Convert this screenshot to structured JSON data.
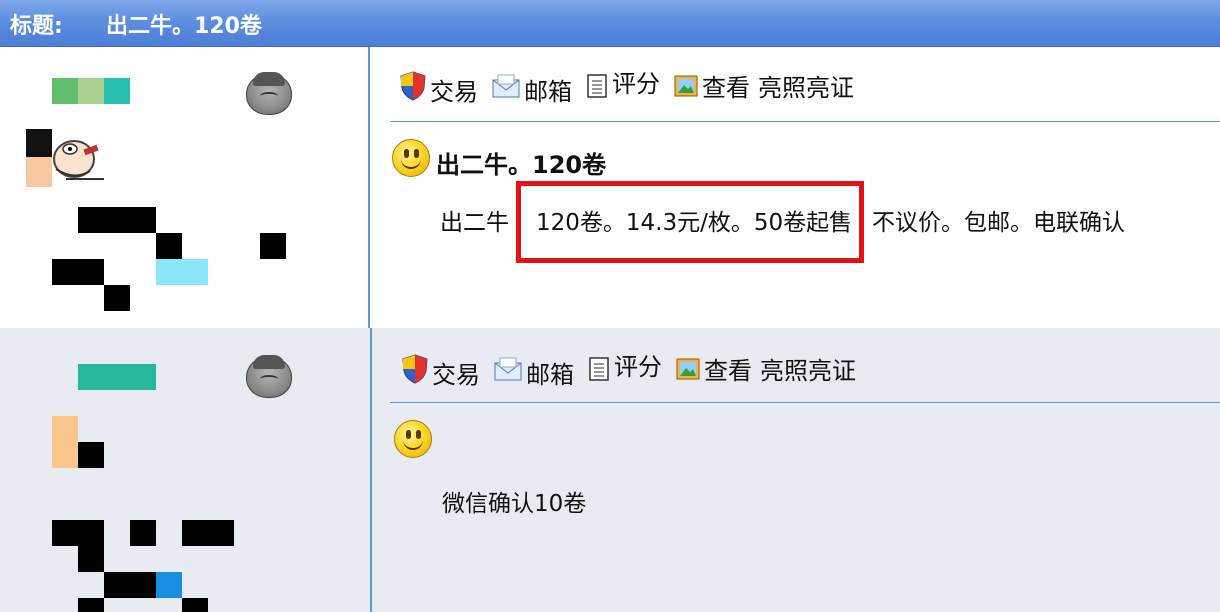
{
  "title_bar": {
    "label": "标题:",
    "title": "出二牛。120卷"
  },
  "posts": [
    {
      "toolbar": {
        "trade": "交易",
        "mailbox": "邮箱",
        "rating": "评分",
        "view": "查看",
        "show_license": "亮照亮证"
      },
      "post_title": "出二牛。120卷",
      "body": {
        "prefix": "出二牛",
        "highlighted": "120卷。14.3元/枚。50卷起售",
        "suffix": "不议价。包邮。电联确认"
      }
    },
    {
      "toolbar": {
        "trade": "交易",
        "mailbox": "邮箱",
        "rating": "评分",
        "view": "查看",
        "show_license": "亮照亮证"
      },
      "post_title": "",
      "body": {
        "text": "微信确认10卷"
      }
    }
  ],
  "icons": [
    "shield-icon",
    "mail-icon",
    "document-icon",
    "picture-icon",
    "smiley-icon",
    "gray-face-avatar-icon",
    "popeye-avatar-icon"
  ],
  "colors": {
    "title_bar": "#5d8ee0",
    "divider": "#5b9bd5",
    "highlight_box": "#e41212",
    "post2_bg": "#e8ebf1"
  }
}
